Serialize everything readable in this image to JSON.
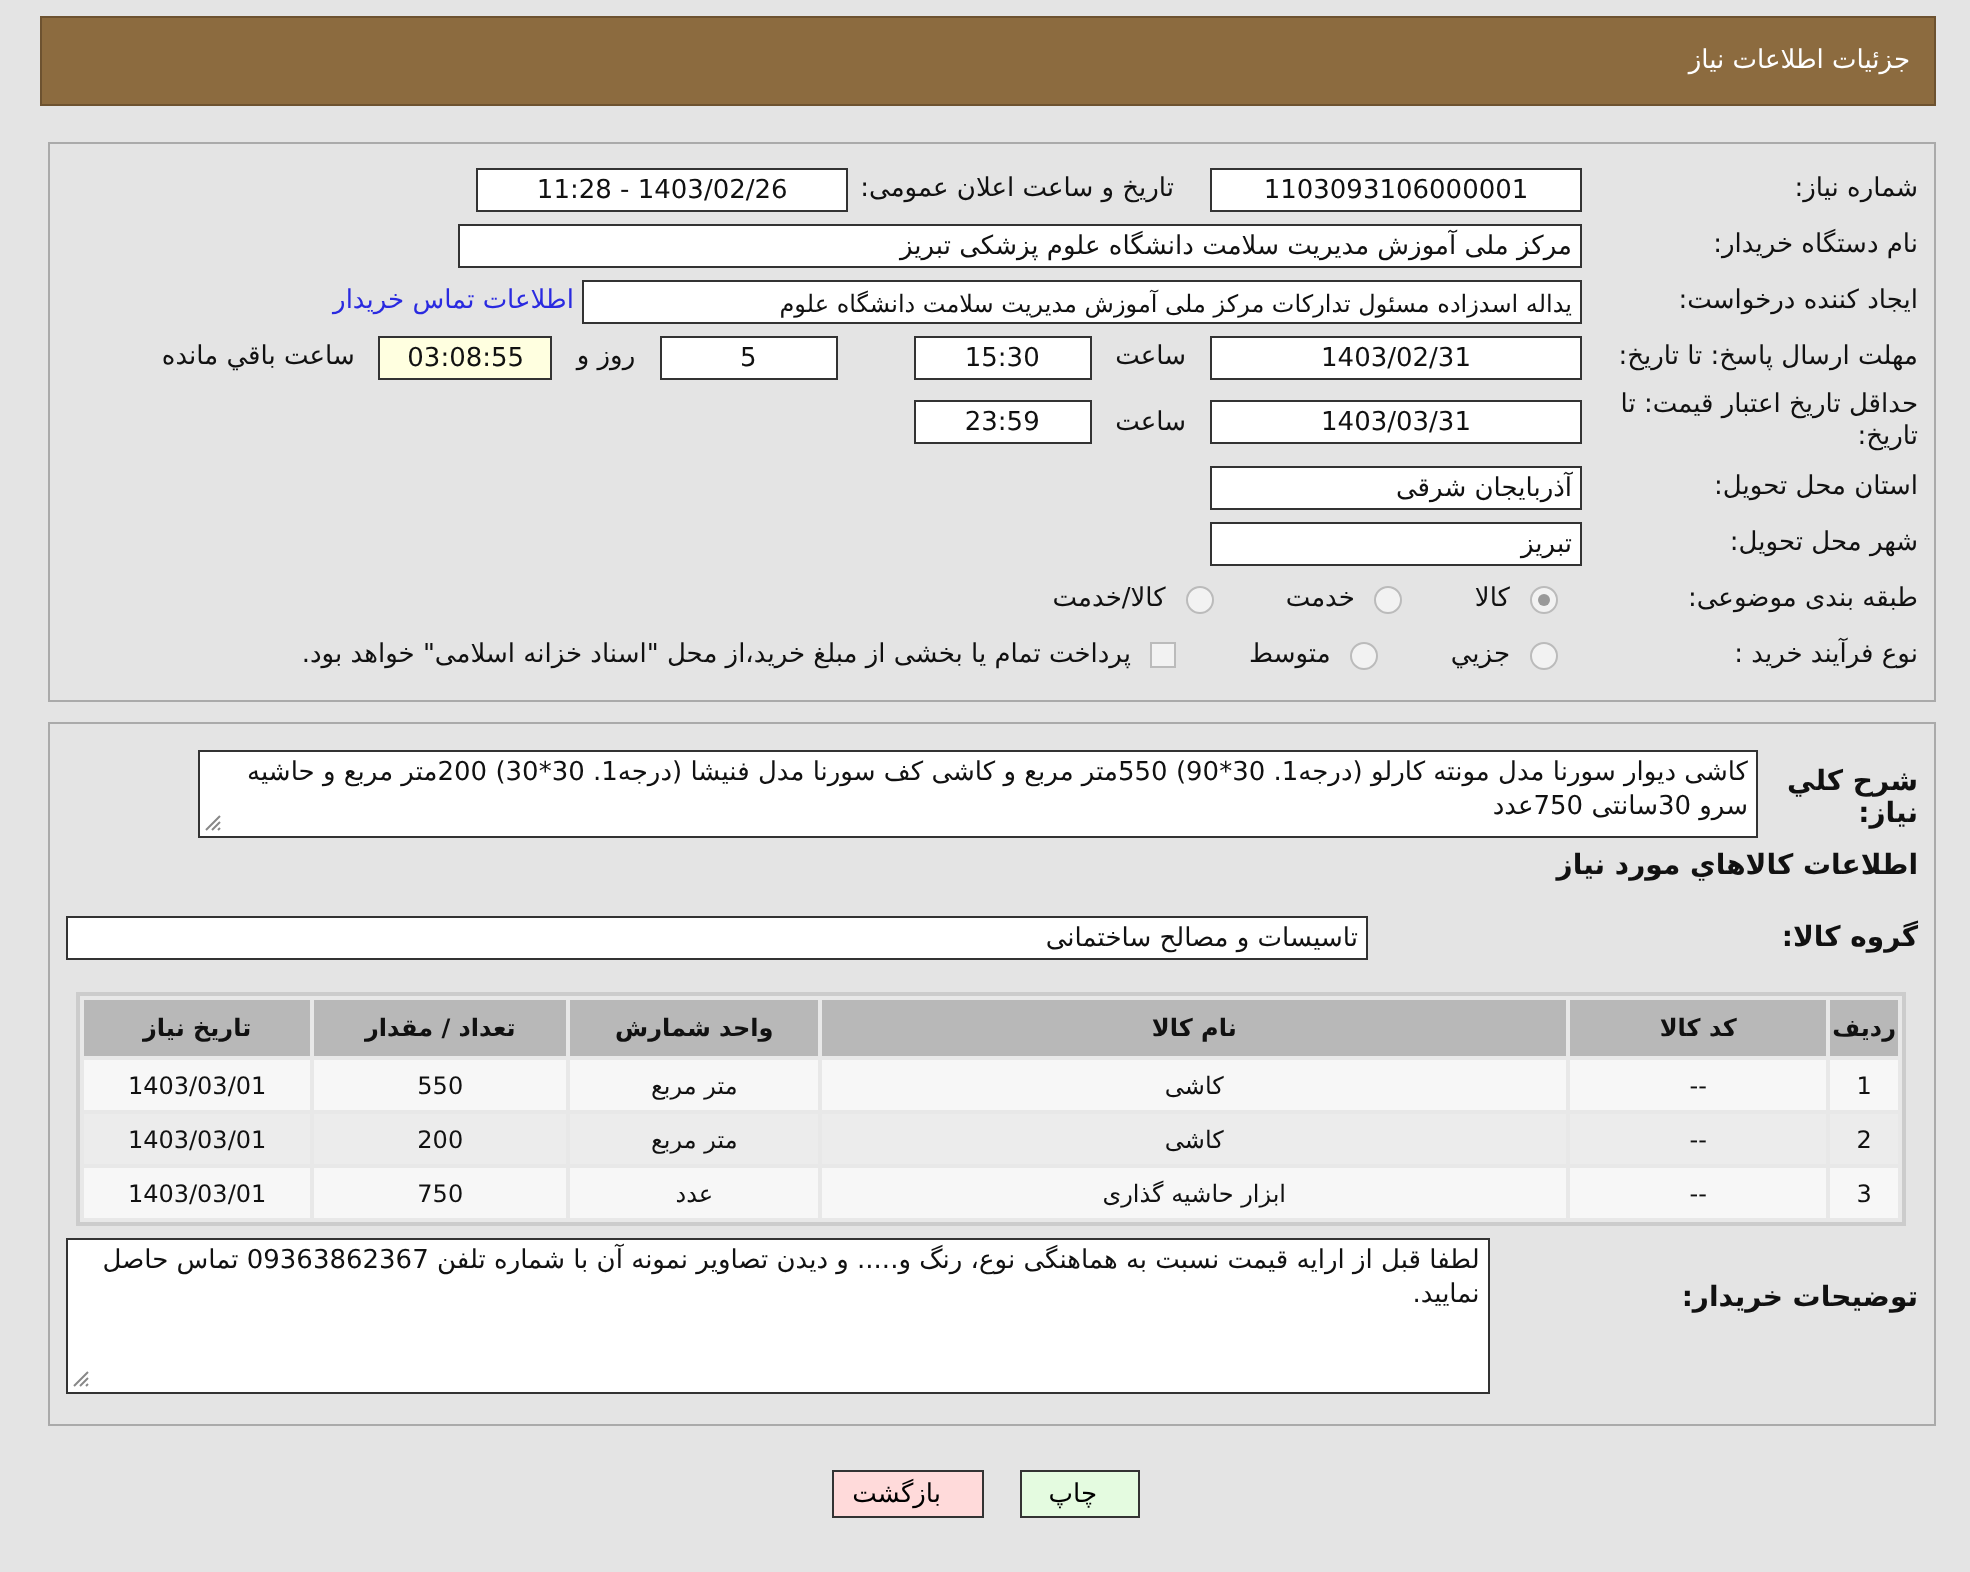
{
  "header": {
    "title": "جزئیات اطلاعات نیاز"
  },
  "details": {
    "need_number": {
      "label": "شماره نیاز:",
      "value": "1103093106000001"
    },
    "announce": {
      "label": "تاریخ و ساعت اعلان عمومی:",
      "value": "1403/02/26 - 11:28"
    },
    "buyer_org": {
      "label": "نام دستگاه خریدار:",
      "value": "مرکز ملی آموزش مدیریت سلامت   دانشگاه علوم پزشکی تبریز"
    },
    "requester": {
      "label": "ایجاد کننده درخواست:",
      "value": "یداله اسدزاده مسئول تداركات مرکز ملی آموزش مدیریت سلامت   دانشگاه علوم",
      "link": "اطلاعات تماس خریدار"
    },
    "response_deadline": {
      "label": "مهلت ارسال پاسخ: تا تاریخ:",
      "date": "1403/02/31",
      "time_label": "ساعت",
      "time": "15:30",
      "days": "5",
      "days_label": "روز و",
      "remaining": "03:08:55",
      "remaining_label": "ساعت باقي مانده"
    },
    "validity": {
      "label": "حداقل تاریخ اعتبار قیمت: تا تاریخ:",
      "date": "1403/03/31",
      "time_label": "ساعت",
      "time": "23:59"
    },
    "province": {
      "label": "استان محل تحویل:",
      "value": "آذربایجان شرقی"
    },
    "city": {
      "label": "شهر محل تحویل:",
      "value": "تبریز"
    },
    "category": {
      "label": "طبقه بندی موضوعی:",
      "options": [
        {
          "label": "کالا",
          "selected": true
        },
        {
          "label": "خدمت",
          "selected": false
        },
        {
          "label": "کالا/خدمت",
          "selected": false
        }
      ]
    },
    "purchase_type": {
      "label": "نوع فرآیند خرید :",
      "options": [
        {
          "kind": "radio",
          "label": "جزيي",
          "selected": false
        },
        {
          "kind": "radio",
          "label": "متوسط",
          "selected": false
        },
        {
          "kind": "checkbox",
          "label": "پرداخت تمام یا بخشی از مبلغ خرید،از محل \"اسناد خزانه اسلامی\" خواهد بود.",
          "selected": false
        }
      ]
    }
  },
  "description": {
    "label": "شرح كلي نياز:",
    "value": "کاشی دیوار سورنا مدل مونته کارلو (درجه1. 30*90) 550متر مربع و کاشی کف سورنا مدل فنیشا (درجه1. 30*30) 200متر مربع و حاشیه سرو 30سانتی 750عدد"
  },
  "goods_title": "اطلاعات كالاهاي مورد نياز",
  "goods_group": {
    "label": "گروه کالا:",
    "value": "تاسیسات و مصالح ساختمانی"
  },
  "table": {
    "columns": [
      "ردیف",
      "کد کالا",
      "نام کالا",
      "واحد شمارش",
      "تعداد / مقدار",
      "تاریخ نیاز"
    ],
    "rows": [
      [
        "1",
        "--",
        "کاشی",
        "متر مربع",
        "550",
        "1403/03/01"
      ],
      [
        "2",
        "--",
        "کاشی",
        "متر مربع",
        "200",
        "1403/03/01"
      ],
      [
        "3",
        "--",
        "ابزار حاشیه گذاری",
        "عدد",
        "750",
        "1403/03/01"
      ]
    ]
  },
  "buyer_notes": {
    "label": "توضیحات خریدار:",
    "value": "لطفا قبل از ارایه قیمت نسبت به هماهنگی نوع، رنگ و.....  و دیدن تصاویر نمونه آن با شماره تلفن 09363862367 تماس حاصل نمایید."
  },
  "buttons": [
    {
      "kind": "print",
      "label": "چاپ"
    },
    {
      "kind": "back",
      "label": "بازگشت"
    }
  ]
}
